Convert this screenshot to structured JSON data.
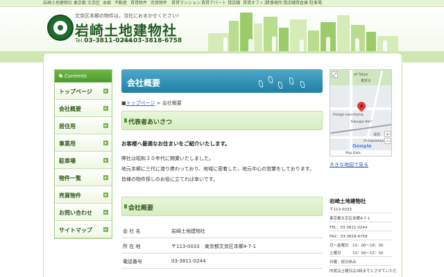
{
  "topbar": {
    "keywords": [
      "岩崎土地建物社",
      "東京都",
      "文京区",
      "本郷",
      "不動産",
      "賃貸物件",
      "売買物件",
      "賃貸マンション",
      "賃貸アパート",
      "貸店舗",
      "賃貸オフィス",
      "貸事務所",
      "貸店舗",
      "貸倉庫",
      "駐車場"
    ]
  },
  "header": {
    "tagline": "文京区本郷の物件は，当社におまかせください!",
    "company": "岩崎土地建物社",
    "tel_label": "Tel.",
    "tel": "03-3811-0244",
    "fax_label": "Fax.",
    "fax": "03-3818-6758"
  },
  "sidebar": {
    "heading": "Contents",
    "items": [
      {
        "label": "トップページ"
      },
      {
        "label": "会社概要"
      },
      {
        "label": "居住用"
      },
      {
        "label": "事業用"
      },
      {
        "label": "駐車場"
      },
      {
        "label": "物件一覧"
      },
      {
        "label": "売買物件"
      },
      {
        "label": "お問い合わせ"
      },
      {
        "label": "サイトマップ"
      }
    ]
  },
  "main": {
    "page_title": "会社概要",
    "breadcrumb_home": "トップページ",
    "breadcrumb_sep": " > ",
    "breadcrumb_current": "会社概要",
    "section1_title": "代表者あいさつ",
    "lead": "お客様へ最適なお住まいをご紹介いたします。",
    "paragraphs": [
      "弊社は昭和３０年代に開業いたしました。",
      "地元本郷に三代に渡り携わっており、地域に密着した、地元中心の営業をしております。",
      "皆様の物件探しのお役に立てれば幸いです。"
    ],
    "section2_title": "会社概要",
    "table": [
      {
        "key": "会 社 名",
        "value": "岩崎土地建物社"
      },
      {
        "key": "所 在 地",
        "value": "〒113-0033　東京都文京区本郷4-7-1"
      },
      {
        "key": "電話番号",
        "value": "03-3811-0244"
      }
    ]
  },
  "map": {
    "label_tokyo": "of Tokyo",
    "label_east": "東京大",
    "label_hongo": "Hongo-sanchome",
    "label_street": "Kasuga-dori",
    "label_ochanomizu": "Ochanomizu",
    "label_yushima": "湯島",
    "footer": "Map Data",
    "google": "Google",
    "larger_link": "大きな地図で見る"
  },
  "info": {
    "name": "岩崎土地建物社",
    "lines": [
      "〒113-0033",
      "東京都文京区本郷4-7-1",
      "TEL：03-3811-0244",
      "FAX：03-3818-6758",
      "月〜金曜日　10：00〜18：00",
      "土曜日　　　10：00〜15：00",
      "日曜・祝日休み",
      "内見は土曜日は3時までとさせていただ"
    ]
  },
  "colors": {
    "brand_green": "#1f5a20",
    "nav_green": "#2e5c18",
    "banner_blue": "#1f7fa6",
    "link_blue": "#2c5fb0"
  }
}
